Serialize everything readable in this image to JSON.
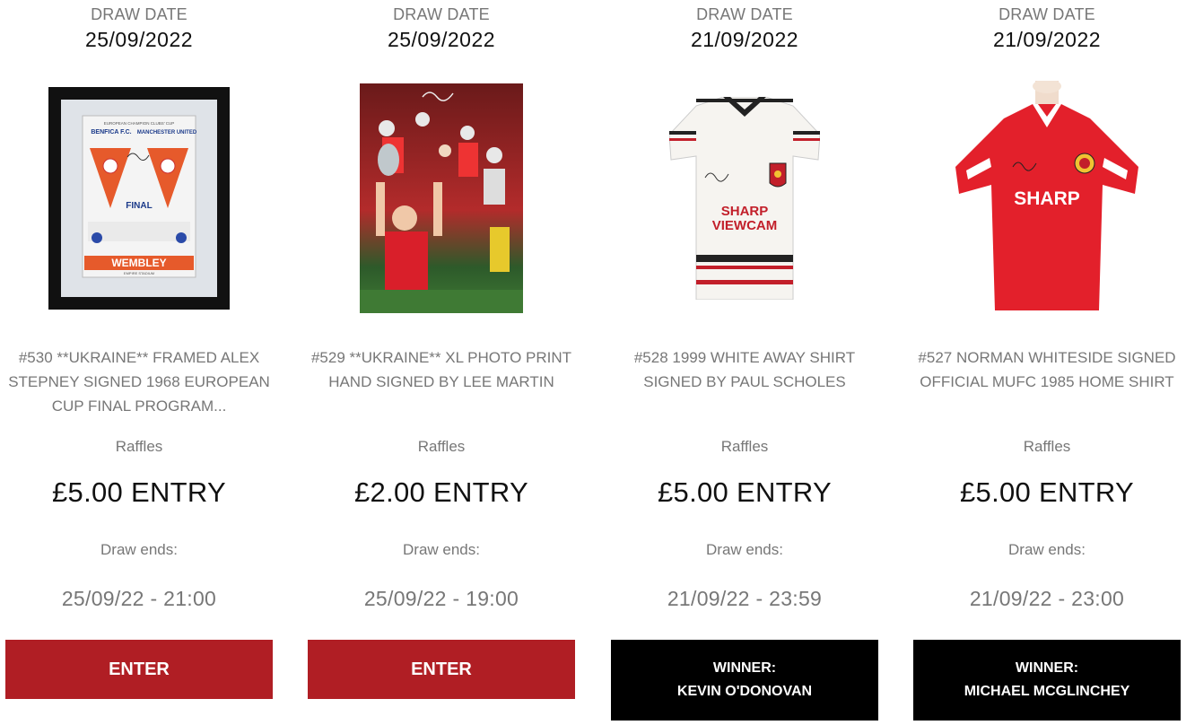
{
  "cards": [
    {
      "draw_label": "DRAW DATE",
      "draw_date": "25/09/2022",
      "image_alt": "framed-programme",
      "title": "#530 **UKRAINE** FRAMED ALEX STEPNEY SIGNED 1968 EUROPEAN CUP FINAL PROGRAM...",
      "programme_texts": {
        "header": "EUROPEAN CHAMPION CLUBS' CUP",
        "team_left": "BENFICA F.C.",
        "team_right": "MANCHESTER UNITED",
        "final": "FINAL",
        "venue": "WEMBLEY",
        "venue_sub": "EMPIRE STADIUM"
      },
      "category": "Raffles",
      "price": "£5.00 ENTRY",
      "ends_label": "Draw ends:",
      "ends_time": "25/09/22 - 21:00",
      "action": {
        "type": "enter",
        "label": "ENTER"
      }
    },
    {
      "draw_label": "DRAW DATE",
      "draw_date": "25/09/2022",
      "image_alt": "photo-print",
      "title": "#529 **UKRAINE** XL PHOTO PRINT HAND SIGNED BY LEE MARTIN",
      "category": "Raffles",
      "price": "£2.00 ENTRY",
      "ends_label": "Draw ends:",
      "ends_time": "25/09/22 - 19:00",
      "action": {
        "type": "enter",
        "label": "ENTER"
      }
    },
    {
      "draw_label": "DRAW DATE",
      "draw_date": "21/09/2022",
      "image_alt": "white-away-shirt",
      "title": "#528 1999 WHITE AWAY SHIRT SIGNED BY PAUL SCHOLES",
      "shirt_sponsor": [
        "SHARP",
        "VIEWCAM"
      ],
      "category": "Raffles",
      "price": "£5.00 ENTRY",
      "ends_label": "Draw ends:",
      "ends_time": "21/09/22 - 23:59",
      "action": {
        "type": "winner",
        "label": "WINNER:",
        "name": "KEVIN O'DONOVAN"
      }
    },
    {
      "draw_label": "DRAW DATE",
      "draw_date": "21/09/2022",
      "image_alt": "red-home-shirt",
      "title": "#527 NORMAN WHITESIDE SIGNED OFFICIAL MUFC 1985 HOME SHIRT",
      "shirt_sponsor": [
        "SHARP"
      ],
      "category": "Raffles",
      "price": "£5.00 ENTRY",
      "ends_label": "Draw ends:",
      "ends_time": "21/09/22 - 23:00",
      "action": {
        "type": "winner",
        "label": "WINNER:",
        "name": "MICHAEL MCGLINCHEY"
      }
    }
  ],
  "colors": {
    "enter_button": "#b01e24",
    "winner_box": "#000000",
    "muted_text": "#777777",
    "strong_text": "#111111"
  }
}
